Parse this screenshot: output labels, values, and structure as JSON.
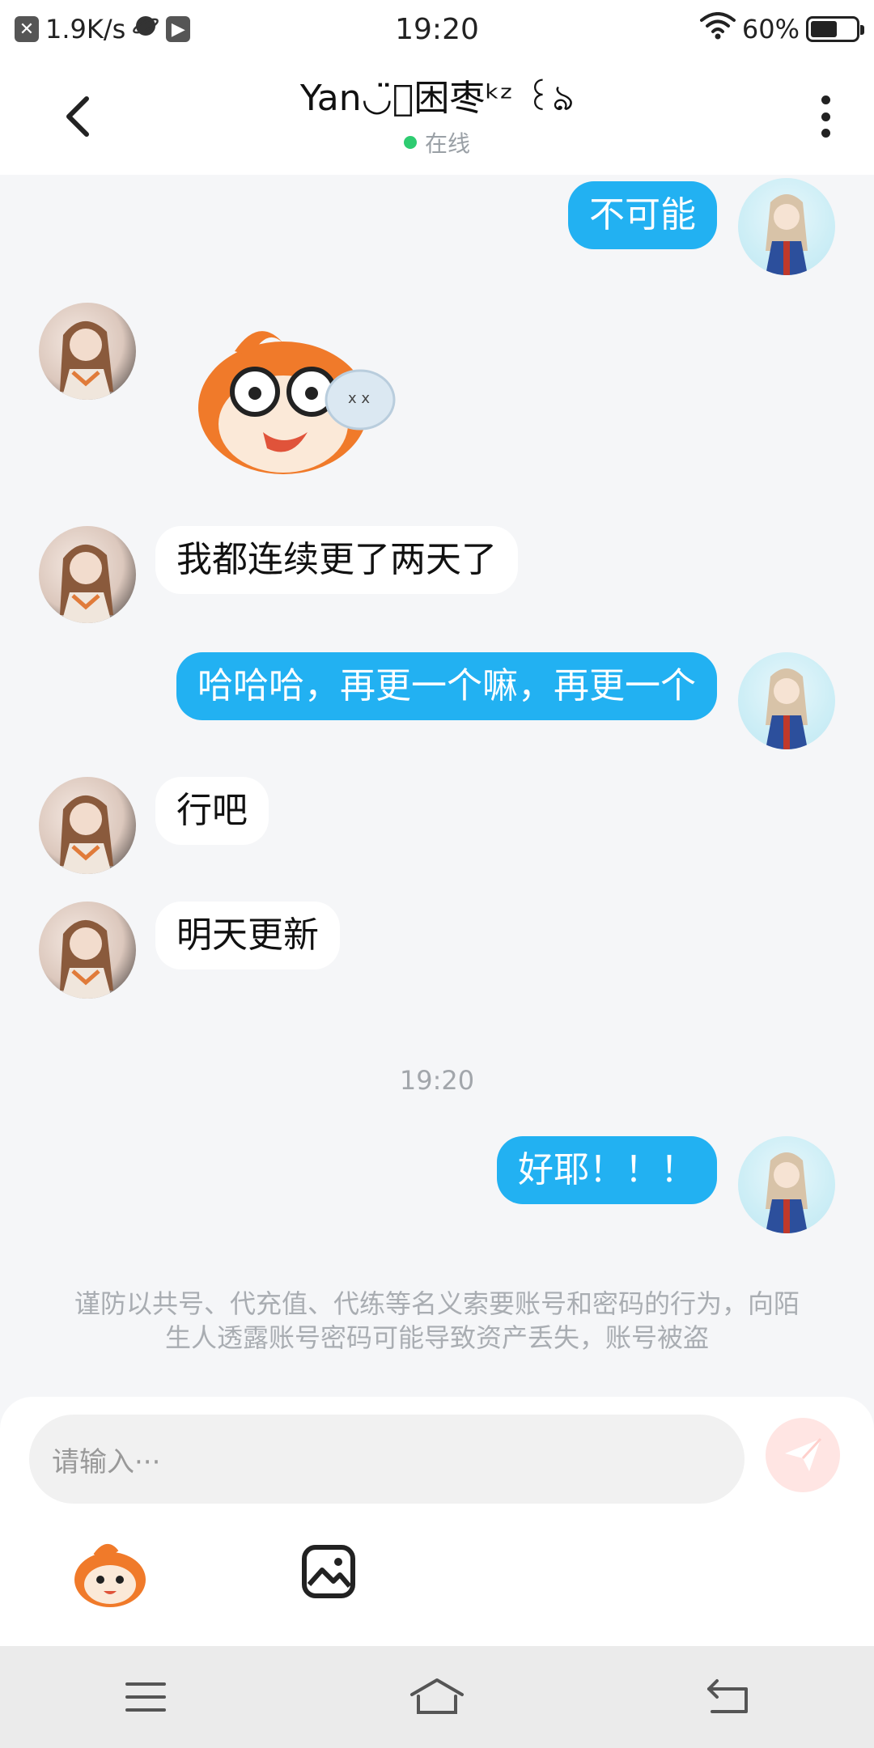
{
  "status_bar": {
    "network_speed": "1.9K/s",
    "time": "19:20",
    "battery": "60%",
    "battery_level": 0.6
  },
  "header": {
    "title": "Yan◡̈⃝困枣ᵏᶻ  ꒰ঌ",
    "status": "在线",
    "back_icon": "back-arrow-icon",
    "more_icon": "more-vertical-icon"
  },
  "messages": [
    {
      "side": "out",
      "type": "text",
      "text": "不可能"
    },
    {
      "side": "in",
      "type": "sticker",
      "sticker": "fish-sticker"
    },
    {
      "side": "in",
      "type": "text",
      "text": "我都连续更了两天了"
    },
    {
      "side": "out",
      "type": "text",
      "text": "哈哈哈，再更一个嘛，再更一个"
    },
    {
      "side": "in",
      "type": "text",
      "text": "行吧"
    },
    {
      "side": "in",
      "type": "text",
      "text": "明天更新"
    },
    {
      "side": "system",
      "type": "time",
      "text": "19:20"
    },
    {
      "side": "out",
      "type": "text",
      "text": "好耶！！！"
    }
  ],
  "notice": "谨防以共号、代充值、代练等名义索要账号和密码的行为，向陌生人透露账号密码可能导致资产丢失，账号被盗",
  "input": {
    "placeholder": "请输入···"
  },
  "colors": {
    "outgoing_bubble": "#22b1f2",
    "incoming_bubble": "#ffffff",
    "chat_background": "#f5f6f8",
    "online": "#2ecc71",
    "send_button": "#ffe5e3"
  },
  "nav_bar": {
    "buttons": [
      "menu-icon",
      "home-icon",
      "back-icon"
    ]
  }
}
